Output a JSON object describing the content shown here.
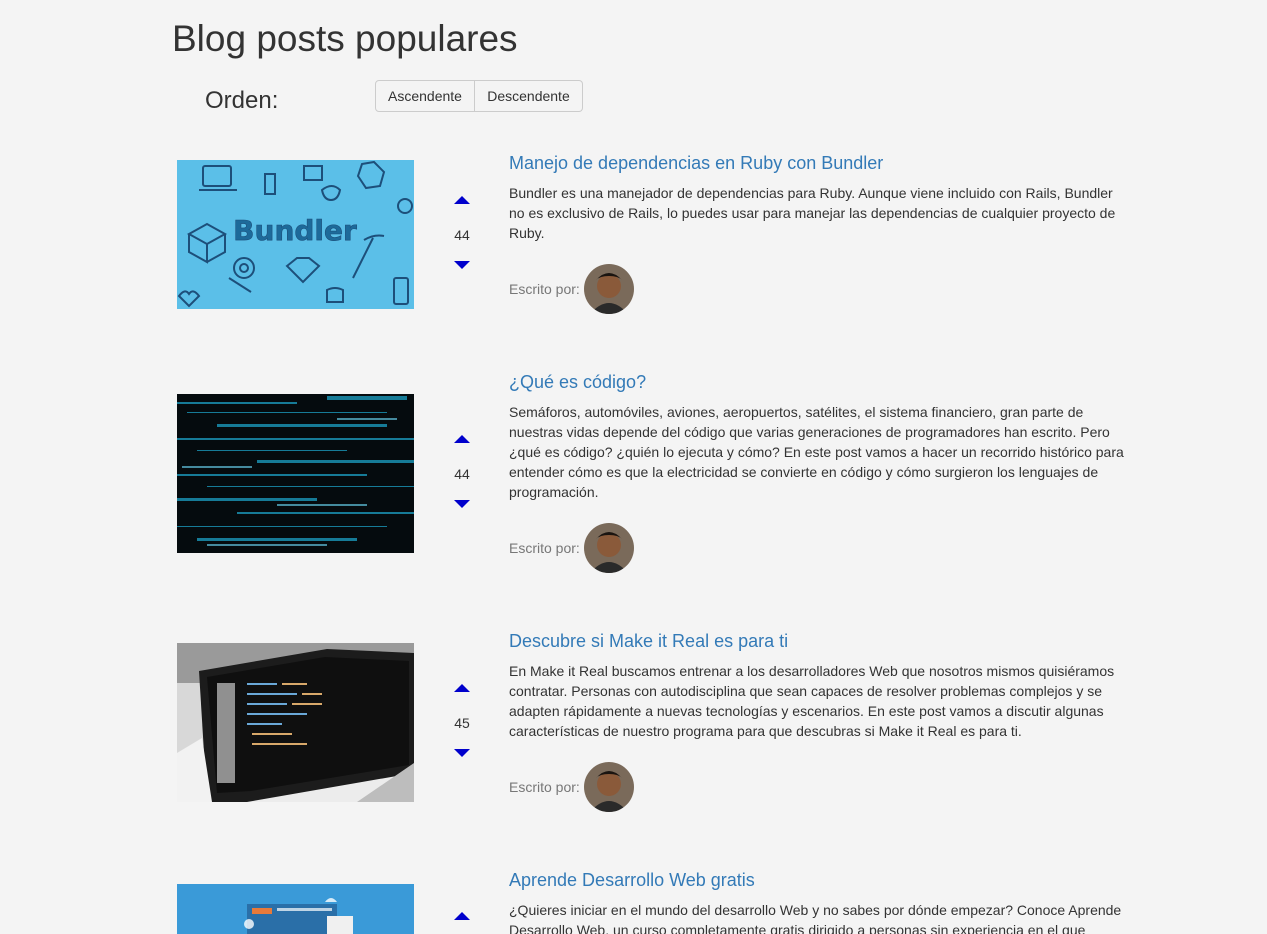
{
  "page": {
    "title": "Blog posts populares"
  },
  "sort": {
    "label": "Orden:",
    "asc": "Ascendente",
    "desc": "Descendente"
  },
  "author_label": "Escrito por:",
  "posts": [
    {
      "title": "Manejo de dependencias en Ruby con Bundler",
      "excerpt": "Bundler es una manejador de dependencias para Ruby. Aunque viene incluido con Rails, Bundler no es exclusivo de Rails, lo puedes usar para manejar las dependencias de cualquier proyecto de Ruby.",
      "votes": "44",
      "image": "bundler-illustration"
    },
    {
      "title": "¿Qué es código?",
      "excerpt": "Semáforos, automóviles, aviones, aeropuertos, satélites, el sistema financiero, gran parte de nuestras vidas depende del código que varias generaciones de programadores han escrito. Pero ¿qué es código? ¿quién lo ejecuta y cómo? En este post vamos a hacer un recorrido histórico para entender cómo es que la electricidad se convierte en código y cómo surgieron los lenguajes de programación.",
      "votes": "44",
      "image": "code-matrix"
    },
    {
      "title": "Descubre si Make it Real es para ti",
      "excerpt": "En Make it Real buscamos entrenar a los desarrolladores Web que nosotros mismos quisiéramos contratar. Personas con autodisciplina que sean capaces de resolver problemas complejos y se adapten rápidamente a nuevas tecnologías y escenarios. En este post vamos a discutir algunas características de nuestro programa para que descubras si Make it Real es para ti.",
      "votes": "45",
      "image": "laptop-photo"
    },
    {
      "title": "Aprende Desarrollo Web gratis",
      "excerpt": "¿Quieres iniciar en el mundo del desarrollo Web y no sabes por dónde empezar? Conoce Aprende Desarrollo Web, un curso completamente gratis dirigido a personas sin experiencia en el que",
      "votes": "",
      "image": "web-dev-illustration"
    }
  ],
  "colors": {
    "link": "#337ab7",
    "arrow": "#0000cc",
    "bundler_bg": "#5bbfe8"
  }
}
